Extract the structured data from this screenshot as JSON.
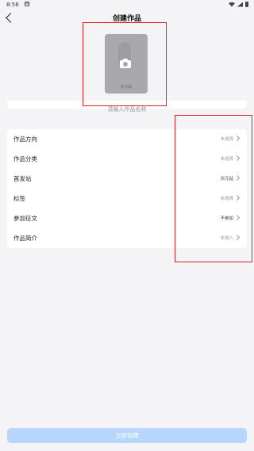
{
  "status_bar": {
    "time": "8:56",
    "notification_glyph": "✉"
  },
  "header": {
    "title": "创建作品"
  },
  "cover": {
    "logo_text": "次元站"
  },
  "name_field": {
    "placeholder": "请输入作品名称",
    "value": ""
  },
  "settings": {
    "rows": [
      {
        "label": "作品方向",
        "value": "未选择"
      },
      {
        "label": "作品分类",
        "value": "未选择"
      },
      {
        "label": "首发站",
        "value": "次元站"
      },
      {
        "label": "标签",
        "value": "未选择"
      },
      {
        "label": "参加征文",
        "value": "不参加"
      },
      {
        "label": "作品简介",
        "value": "未填入"
      }
    ]
  },
  "footer": {
    "create_label": "立即创建"
  },
  "colors": {
    "background": "#f4f3f5",
    "button": "#b8d5fb",
    "highlight": "#e0231f"
  }
}
